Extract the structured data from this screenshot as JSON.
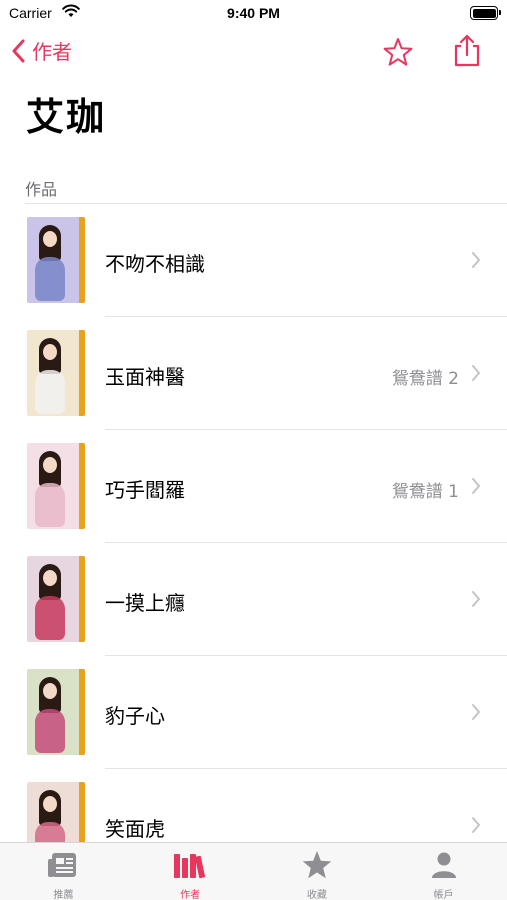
{
  "status_bar": {
    "carrier": "Carrier",
    "time": "9:40 PM"
  },
  "nav": {
    "back_label": "作者"
  },
  "author_name": "艾珈",
  "section_title": "作品",
  "colors": {
    "accent": "#e8375f",
    "secondary_text": "#8e8e93",
    "separator": "#e4e4e6",
    "spine": "#e9a21c"
  },
  "books": [
    {
      "title": "不吻不相識",
      "series": "",
      "cover_bg": "#c9c4e8",
      "dress": "#7a86c9"
    },
    {
      "title": "玉面神醫",
      "series": "鴛鴦譜 2",
      "cover_bg": "#f3e6cf",
      "dress": "#f1f1f1"
    },
    {
      "title": "巧手閻羅",
      "series": "鴛鴦譜 1",
      "cover_bg": "#f4dfe6",
      "dress": "#e9b8c8"
    },
    {
      "title": "一摸上癮",
      "series": "",
      "cover_bg": "#e7d6e0",
      "dress": "#c73a5c"
    },
    {
      "title": "豹子心",
      "series": "",
      "cover_bg": "#d9e2c7",
      "dress": "#c44b7a"
    },
    {
      "title": "笑面虎",
      "series": "",
      "cover_bg": "#eedcd6",
      "dress": "#d46a8a"
    }
  ],
  "tabs": [
    {
      "label": "推薦",
      "icon": "newspaper-icon",
      "active": false
    },
    {
      "label": "作者",
      "icon": "books-icon",
      "active": true
    },
    {
      "label": "收藏",
      "icon": "star-filled-icon",
      "active": false
    },
    {
      "label": "帳戶",
      "icon": "person-icon",
      "active": false
    }
  ]
}
